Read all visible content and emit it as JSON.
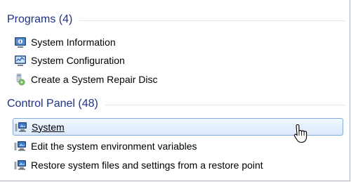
{
  "programs": {
    "header": "Programs (4)",
    "items": [
      {
        "label": "System Information",
        "icon": "system-information-icon"
      },
      {
        "label": "System Configuration",
        "icon": "system-configuration-icon"
      },
      {
        "label": "Create a System Repair Disc",
        "icon": "repair-disc-icon"
      }
    ]
  },
  "control_panel": {
    "header": "Control Panel (48)",
    "items": [
      {
        "label": "System",
        "icon": "control-panel-system-icon",
        "selected": true
      },
      {
        "label": "Edit the system environment variables",
        "icon": "control-panel-system-icon"
      },
      {
        "label": "Restore system files and settings from a restore point",
        "icon": "control-panel-system-icon"
      }
    ]
  },
  "colors": {
    "header_text": "#1e3287",
    "selection_border": "#84acdd",
    "selection_fill": "#dce9fb"
  }
}
